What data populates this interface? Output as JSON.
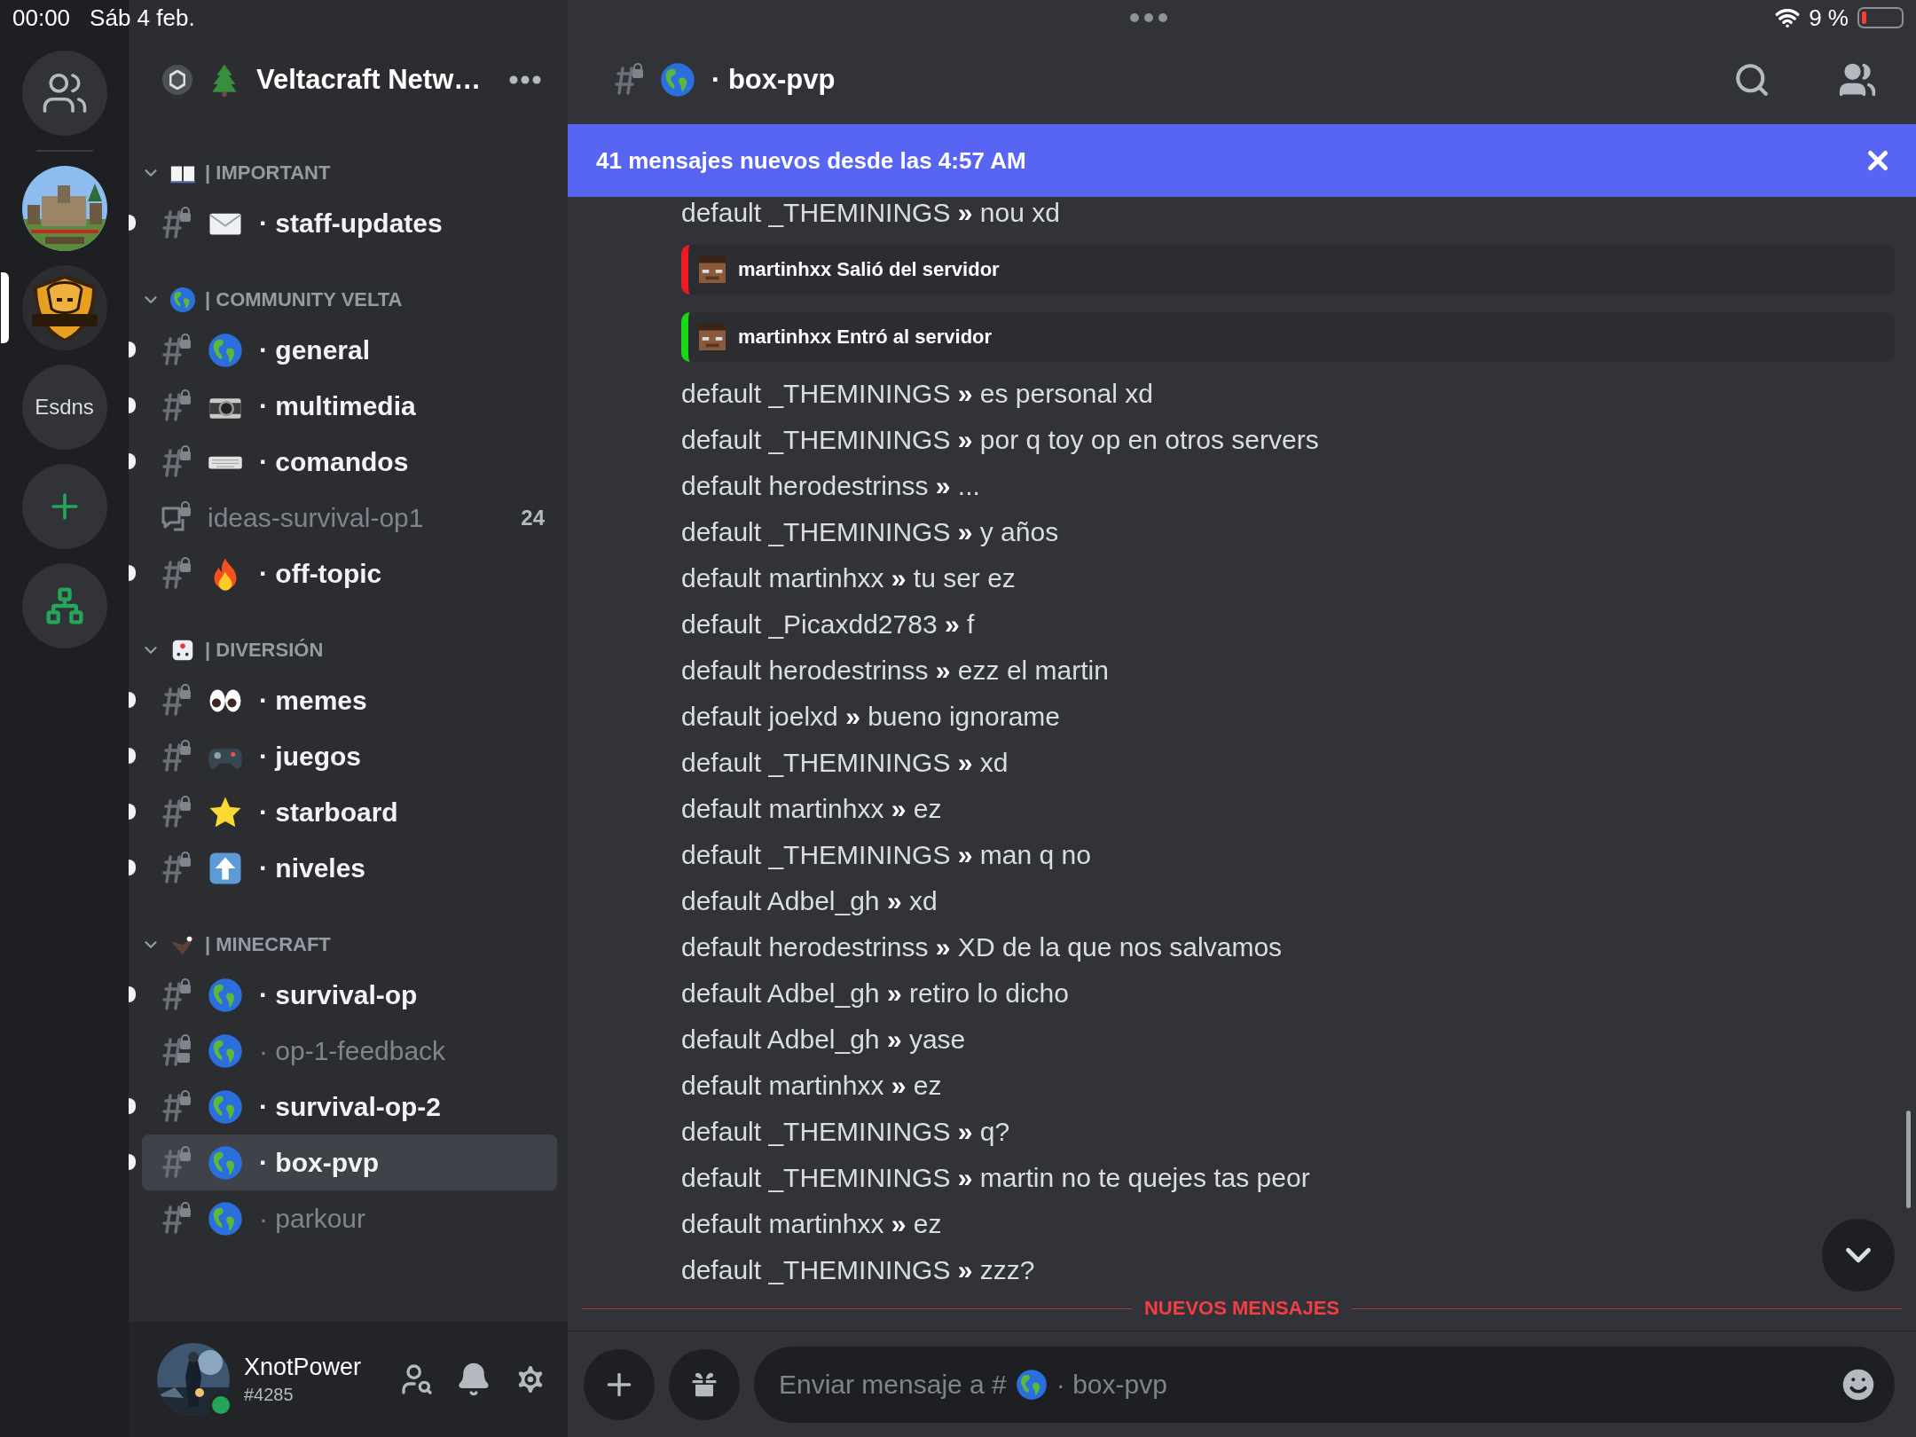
{
  "status_bar": {
    "time": "00:00",
    "date": "Sáb 4 feb.",
    "battery": "9 %"
  },
  "servers": [
    {
      "kind": "friends",
      "selected": false
    },
    {
      "kind": "picture",
      "selected": false
    },
    {
      "kind": "logo",
      "selected": true
    },
    {
      "kind": "text",
      "label": "Esdns",
      "selected": false
    },
    {
      "kind": "add",
      "selected": false
    },
    {
      "kind": "explore",
      "selected": false
    }
  ],
  "server": {
    "name": "Veltacraft Netw…"
  },
  "categories": [
    {
      "name": "| IMPORTANT",
      "expanded": true,
      "channels": [
        {
          "kind": "locked",
          "name": "· staff-updates",
          "unread": true,
          "selected": false
        }
      ]
    },
    {
      "name": "| COMMUNITY VELTA",
      "expanded": true,
      "channels": [
        {
          "kind": "locked",
          "name": "· general",
          "unread": true,
          "selected": false
        },
        {
          "kind": "locked",
          "name": "· multimedia",
          "unread": true,
          "selected": false
        },
        {
          "kind": "locked",
          "name": "· comandos",
          "unread": true,
          "selected": false
        },
        {
          "kind": "forum",
          "name": "ideas-survival-op1",
          "count": "24",
          "unread": false,
          "selected": false
        },
        {
          "kind": "locked",
          "name": "· off-topic",
          "unread": true,
          "selected": false
        }
      ]
    },
    {
      "name": "| DIVERSIÓN",
      "expanded": true,
      "channels": [
        {
          "kind": "locked",
          "name": "· memes",
          "unread": true,
          "selected": false
        },
        {
          "kind": "locked",
          "name": "· juegos",
          "unread": true,
          "selected": false
        },
        {
          "kind": "locked",
          "name": "· starboard",
          "unread": true,
          "selected": false
        },
        {
          "kind": "locked",
          "name": "· niveles",
          "unread": true,
          "selected": false
        }
      ]
    },
    {
      "name": "| MINECRAFT",
      "expanded": true,
      "channels": [
        {
          "kind": "locked",
          "name": "· survival-op",
          "unread": true,
          "selected": false
        },
        {
          "kind": "thread",
          "name": "· op-1-feedback",
          "unread": false,
          "selected": false
        },
        {
          "kind": "locked",
          "name": "· survival-op-2",
          "unread": true,
          "selected": false
        },
        {
          "kind": "locked",
          "name": "· box-pvp",
          "unread": true,
          "selected": true
        },
        {
          "kind": "locked",
          "name": "· parkour",
          "unread": false,
          "selected": false
        }
      ]
    }
  ],
  "user": {
    "name": "XnotPower",
    "tag": "#4285",
    "online": true
  },
  "channel": {
    "name": "· box-pvp"
  },
  "banner": {
    "text": "41 mensajes nuevos desde las 4:57 AM"
  },
  "messages": [
    {
      "kind": "text",
      "text": "default _THEMININGS **»** nou xd"
    },
    {
      "kind": "event",
      "text": "martinhxx Salió del servidor",
      "color": "#ed1c24"
    },
    {
      "kind": "event",
      "text": "martinhxx Entró al servidor",
      "color": "#18d818"
    },
    {
      "kind": "text",
      "text": "default _THEMININGS **»** es personal xd"
    },
    {
      "kind": "text",
      "text": "default _THEMININGS **»** por q toy op en otros servers"
    },
    {
      "kind": "text",
      "text": "default herodestrinss **»** ..."
    },
    {
      "kind": "text",
      "text": "default _THEMININGS **»** y años"
    },
    {
      "kind": "text",
      "text": "default martinhxx **»** tu ser ez"
    },
    {
      "kind": "text",
      "text": "default _Picaxdd2783 **»** f"
    },
    {
      "kind": "text",
      "text": "default herodestrinss **»** ezz el martin"
    },
    {
      "kind": "text",
      "text": "default joelxd **»** bueno ignorame"
    },
    {
      "kind": "text",
      "text": "default _THEMININGS **»** xd"
    },
    {
      "kind": "text",
      "text": "default martinhxx **»** ez"
    },
    {
      "kind": "text",
      "text": "default _THEMININGS **»** man q no"
    },
    {
      "kind": "text",
      "text": "default Adbel_gh **»** xd"
    },
    {
      "kind": "text",
      "text": "default herodestrinss **»** XD de la que nos salvamos"
    },
    {
      "kind": "text",
      "text": "default Adbel_gh **»** retiro lo dicho"
    },
    {
      "kind": "text",
      "text": "default Adbel_gh **»** yase"
    },
    {
      "kind": "text",
      "text": "default martinhxx **»** ez"
    },
    {
      "kind": "text",
      "text": "default _THEMININGS **»** q?"
    },
    {
      "kind": "text",
      "text": "default _THEMININGS **»** martin no te quejes tas peor"
    },
    {
      "kind": "text",
      "text": "default martinhxx **»** ez"
    },
    {
      "kind": "text",
      "text": "default _THEMININGS **»** zzz?"
    }
  ],
  "new_divider": "NUEVOS MENSAJES",
  "composer": {
    "placeholder": "Enviar mensaje a #",
    "channel": "· box-pvp"
  }
}
